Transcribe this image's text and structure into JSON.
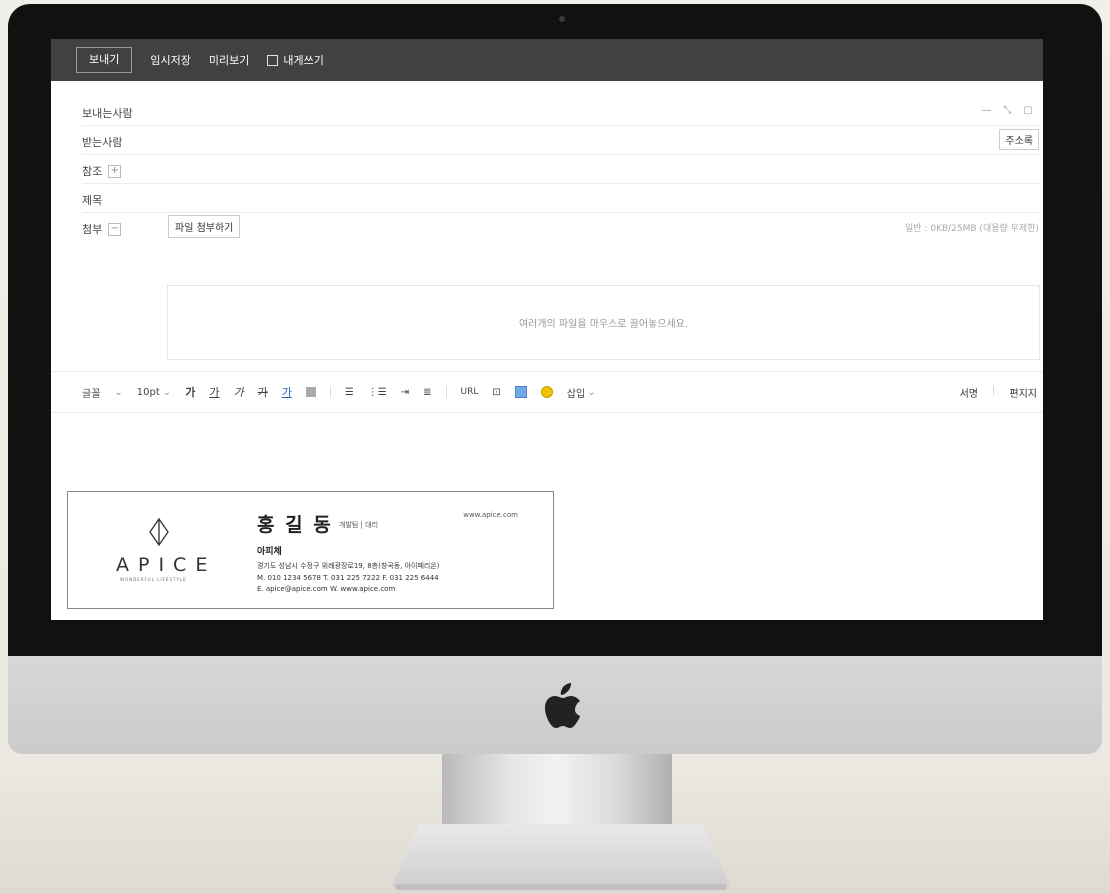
{
  "toolbar": {
    "send": "보내기",
    "save_draft": "임시저장",
    "preview": "미리보기",
    "to_self": "내게쓰기"
  },
  "form": {
    "sender_label": "보내는사람",
    "recipient_label": "받는사람",
    "address_book": "주소록",
    "cc_label": "참조",
    "cc_toggle": "+",
    "subject_label": "제목",
    "attach_label": "첨부",
    "attach_toggle": "−",
    "attach_button": "파일 첨부하기",
    "attach_info": "일반 : 0KB/25MB (대용량 무제한)",
    "dropzone_text": "여러개의 파일을 마우스로 끌어놓으세요."
  },
  "editor": {
    "font": "글꼴",
    "size": "10pt",
    "bold": "가",
    "underline": "가",
    "italic": "가",
    "strike": "가",
    "color": "가",
    "url": "URL",
    "insert": "삽입",
    "signature": "서명",
    "stationery": "편지지"
  },
  "signature": {
    "logo": "APICE",
    "logo_tagline": "WONDERFUL LIFESTYLE",
    "name": "홍 길 동",
    "title": "개발팀 | 대리",
    "website": "www.apice.com",
    "company": "아피체",
    "address": "경기도 성남시 수정구 위례광장로19, 8층(창곡동, 아이페리온)",
    "phones": "M. 010 1234 5678  T. 031 225 7222  F. 031 225 6444",
    "contact": "E. apice@apice.com  W. www.apice.com"
  }
}
